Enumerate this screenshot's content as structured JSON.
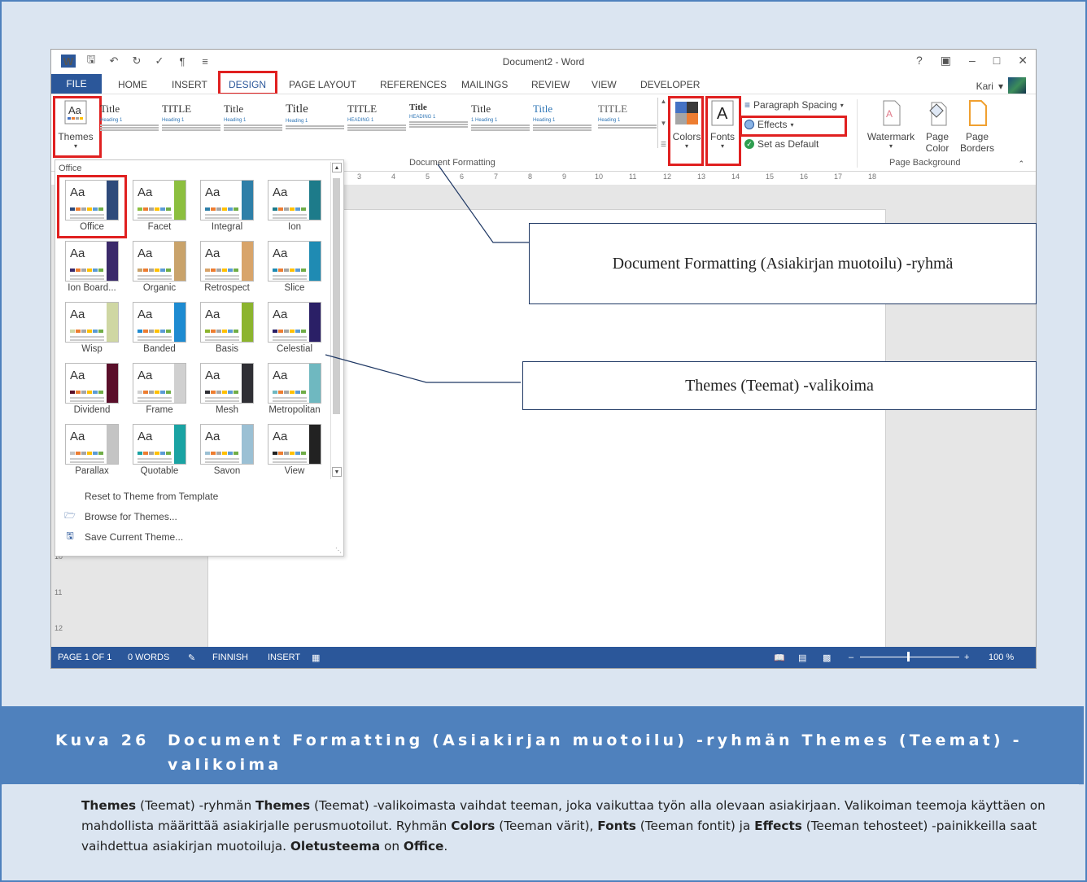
{
  "window": {
    "title": "Document2 - Word",
    "user": "Kari"
  },
  "tabs": [
    "FILE",
    "HOME",
    "INSERT",
    "DESIGN",
    "PAGE LAYOUT",
    "REFERENCES",
    "MAILINGS",
    "REVIEW",
    "VIEW",
    "DEVELOPER"
  ],
  "ribbon": {
    "themes_label": "Themes",
    "gallery_titles": [
      "Title",
      "TITLE",
      "Title",
      "Title",
      "TITLE",
      "Title",
      "Title",
      "Title",
      "TITLE"
    ],
    "gallery_headings": [
      "Heading 1",
      "Heading 1",
      "Heading 1",
      "Heading 1",
      "HEADING 1",
      "HEADING 1",
      "1 Heading 1",
      "Heading 1",
      "Heading 1"
    ],
    "document_formatting": "Document Formatting",
    "colors_label": "Colors",
    "fonts_label": "Fonts",
    "paragraph_spacing": "Paragraph Spacing",
    "effects": "Effects",
    "set_as_default": "Set as Default",
    "watermark": "Watermark",
    "page_color": "Page Color",
    "page_borders": "Page Borders",
    "page_background": "Page Background"
  },
  "ruler_ticks": [
    "3",
    "4",
    "5",
    "6",
    "7",
    "8",
    "9",
    "10",
    "11",
    "12",
    "13",
    "14",
    "15",
    "16",
    "17",
    "18"
  ],
  "vruler_ticks": [
    "10",
    "11",
    "12"
  ],
  "dropdown": {
    "heading": "Office",
    "themes": [
      {
        "name": "Office",
        "accent": "#2e4a7a",
        "selected": true
      },
      {
        "name": "Facet",
        "accent": "#8cbf3f"
      },
      {
        "name": "Integral",
        "accent": "#2e7fa8"
      },
      {
        "name": "Ion",
        "accent": "#1d7b8a"
      },
      {
        "name": "Ion Board...",
        "accent": "#3b2a6a"
      },
      {
        "name": "Organic",
        "accent": "#c9a36b"
      },
      {
        "name": "Retrospect",
        "accent": "#d8a46a"
      },
      {
        "name": "Slice",
        "accent": "#1f8bb3"
      },
      {
        "name": "Wisp",
        "accent": "#cfd7a3"
      },
      {
        "name": "Banded",
        "accent": "#1e8bd1"
      },
      {
        "name": "Basis",
        "accent": "#8cb42e"
      },
      {
        "name": "Celestial",
        "accent": "#2a1f66"
      },
      {
        "name": "Dividend",
        "accent": "#5a0f2a"
      },
      {
        "name": "Frame",
        "accent": "#d0d0d0"
      },
      {
        "name": "Mesh",
        "accent": "#2f2f35"
      },
      {
        "name": "Metropolitan",
        "accent": "#6fb8c0"
      },
      {
        "name": "Parallax",
        "accent": "#c4c4c4"
      },
      {
        "name": "Quotable",
        "accent": "#1aa3a3"
      },
      {
        "name": "Savon",
        "accent": "#9bc0d4"
      },
      {
        "name": "View",
        "accent": "#222222"
      }
    ],
    "menu": [
      "Reset to Theme from Template",
      "Browse for Themes...",
      "Save Current Theme..."
    ]
  },
  "status": {
    "page": "PAGE 1 OF 1",
    "words": "0 WORDS",
    "language": "FINNISH",
    "mode": "INSERT",
    "zoom": "100 %"
  },
  "callouts": {
    "document_formatting": "Document Formatting (Asiakirjan muotoilu) -ryhmä",
    "themes_gallery": "Themes (Teemat) -valikoima"
  },
  "caption": {
    "number": "Kuva 26",
    "text": "Document Formatting (Asiakirjan muotoilu) -ryhmän Themes (Teemat) -valikoima"
  },
  "body": {
    "themes_bold": "Themes",
    "p1a": " (Teemat) -ryhmän ",
    "themes_bold2": "Themes",
    "p1b": " (Teemat) -valikoimasta vaihdat teeman, joka vaikuttaa työn alla olevaan asiakirjaan. Valikoiman teemoja käyttäen on mahdollista määrittää asiakirjalle perusmuotoilut. Ryhmän ",
    "colors_bold": "Colors",
    "p1c": " (Teeman värit), ",
    "fonts_bold": "Fonts",
    "p1d": " (Teeman fontit) ja ",
    "effects_bold": "Effects",
    "p1e": " (Teeman tehosteet) -painikkeilla saat vaihdettua asiakirjan muotoiluja. ",
    "default_bold": "Oletusteema",
    "p1f": " on ",
    "office_bold": "Office",
    "p1g": "."
  }
}
